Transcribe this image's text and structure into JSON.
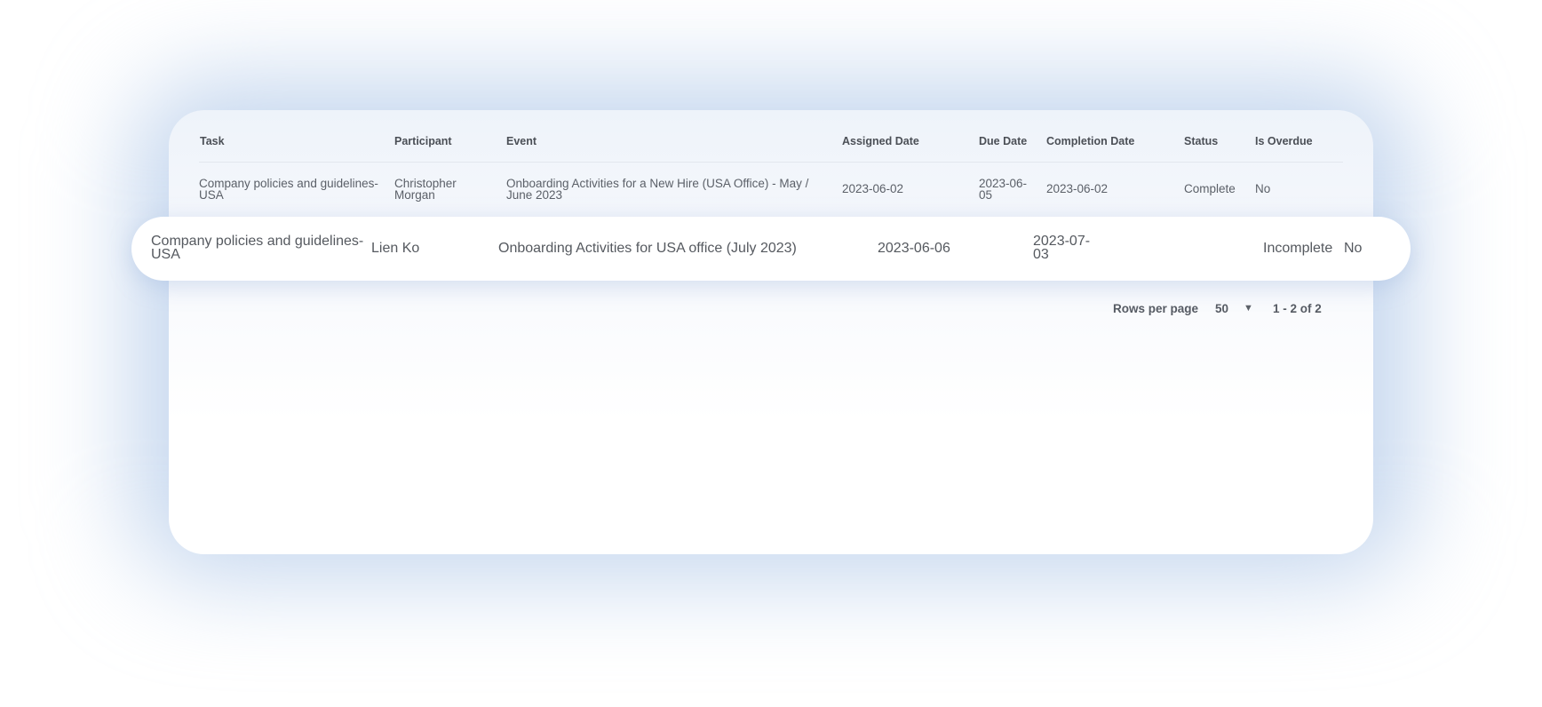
{
  "table": {
    "columns": [
      "Task",
      "Participant",
      "Event",
      "Assigned Date",
      "Due Date",
      "Completion Date",
      "Status",
      "Is Overdue"
    ],
    "rows": [
      {
        "task": "Company policies and guidelines-USA",
        "participant": "Christopher Morgan",
        "event": "Onboarding Activities for a New Hire (USA Office) - May / June 2023",
        "assigned_date": "2023-06-02",
        "due_date": "2023-06-05",
        "completion_date": "2023-06-02",
        "status": "Complete",
        "is_overdue": "No"
      },
      {
        "task": "Company policies and guidelines-USA",
        "participant": "Lien Ko",
        "event": "Onboarding Activities for USA office (July 2023)",
        "assigned_date": "2023-06-06",
        "due_date": "2023-07-03",
        "completion_date": "",
        "status": "Incomplete",
        "is_overdue": "No"
      }
    ]
  },
  "pagination": {
    "rows_per_page_label": "Rows per page",
    "rows_per_page_value": "50",
    "range_label": "1 - 2 of 2"
  },
  "icons": {
    "select_caret": "caret-down-icon"
  },
  "colors": {
    "highlight_shadow": "#8caad7",
    "text": "#55595f",
    "header_text": "#4b4f56"
  }
}
